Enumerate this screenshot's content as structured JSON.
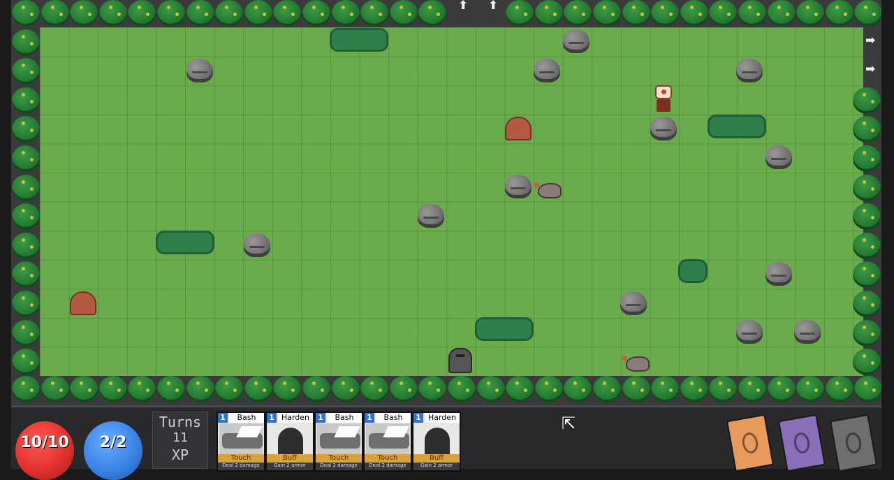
{
  "board": {
    "grass_color": "#6aac4b",
    "tree_color": "#237a32",
    "exit_arrows": [
      "up-arrow-icon",
      "up-arrow-icon",
      "right-arrow-icon",
      "right-arrow-icon"
    ]
  },
  "hud": {
    "health": {
      "value": "10/10",
      "color": "#e0322e"
    },
    "mana": {
      "value": "2/2",
      "color": "#3a84e8"
    },
    "turns_label": "Turns",
    "turns_value": "11",
    "xp_label": "XP",
    "cards": [
      {
        "cost": "1",
        "name": "Bash",
        "type": "Touch",
        "desc": "Deal 2 damage",
        "art": "bash"
      },
      {
        "cost": "1",
        "name": "Harden",
        "type": "Buff",
        "desc": "Gain 2 armor",
        "art": "harden"
      },
      {
        "cost": "1",
        "name": "Bash",
        "type": "Touch",
        "desc": "Deal 2 damage",
        "art": "bash"
      },
      {
        "cost": "1",
        "name": "Bash",
        "type": "Touch",
        "desc": "Deal 2 damage",
        "art": "bash"
      },
      {
        "cost": "1",
        "name": "Harden",
        "type": "Buff",
        "desc": "Gain 2 armor",
        "art": "harden"
      }
    ],
    "decks": [
      {
        "name": "draw-pile",
        "color": "#e89a5c"
      },
      {
        "name": "discard-pile",
        "color": "#8a6fb8"
      },
      {
        "name": "exhaust-pile",
        "color": "#6e6e6e"
      }
    ]
  }
}
